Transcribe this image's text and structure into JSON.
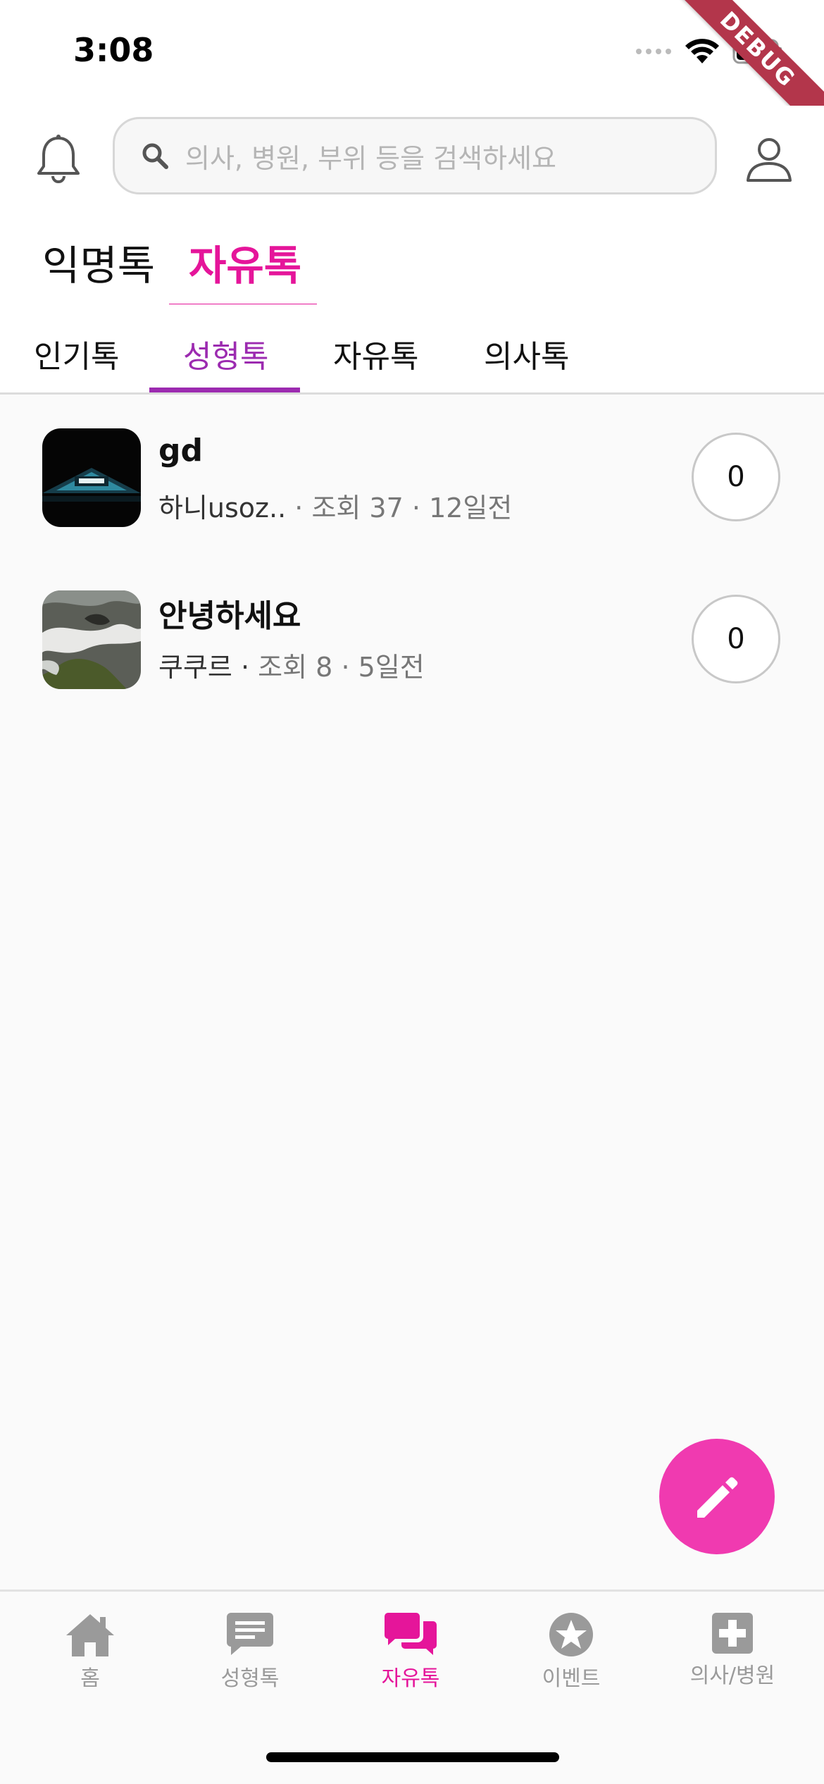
{
  "status_bar": {
    "time": "3:08",
    "debug_label": "DEBUG"
  },
  "search": {
    "placeholder": "의사, 병원, 부위 등을 검색하세요"
  },
  "main_tabs": [
    {
      "label": "익명톡",
      "active": false
    },
    {
      "label": "자유톡",
      "active": true
    }
  ],
  "sub_tabs": [
    {
      "label": "인기톡",
      "active": false
    },
    {
      "label": "성형톡",
      "active": true
    },
    {
      "label": "자유톡",
      "active": false
    },
    {
      "label": "의사톡",
      "active": false
    }
  ],
  "posts": [
    {
      "title": "gd",
      "author": "하니usoz..",
      "views": "조회 37",
      "time": "12일전",
      "comments": "0",
      "sep": "·"
    },
    {
      "title": "안녕하세요",
      "author": "쿠쿠르",
      "views": "조회 8",
      "time": "5일전",
      "comments": "0",
      "sep": "·"
    }
  ],
  "bottom_nav": [
    {
      "label": "홈",
      "icon": "home-icon",
      "active": false
    },
    {
      "label": "성형톡",
      "icon": "chat-bubble-icon",
      "active": false
    },
    {
      "label": "자유톡",
      "icon": "forum-icon",
      "active": true
    },
    {
      "label": "이벤트",
      "icon": "star-circle-icon",
      "active": false
    },
    {
      "label": "의사/병원",
      "icon": "medical-cross-icon",
      "active": false
    }
  ],
  "colors": {
    "accent": "#e5159a",
    "sub_accent": "#9c2bb0",
    "fab": "#f03ab0",
    "inactive": "#9a9a9a"
  }
}
